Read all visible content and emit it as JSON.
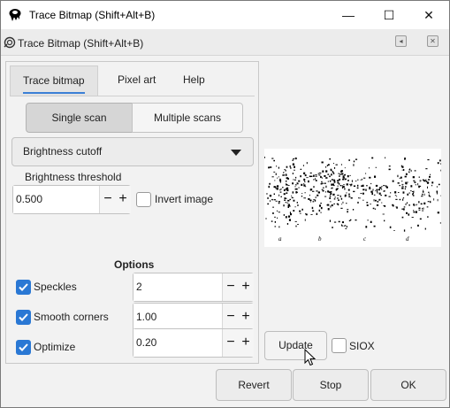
{
  "window": {
    "title": "Trace Bitmap (Shift+Alt+B)",
    "controls": {
      "minimize": "—",
      "maximize": "☐",
      "close": "✕"
    }
  },
  "dock": {
    "title": "Trace Bitmap (Shift+Alt+B)",
    "collapse_icon": "◂",
    "close_icon": "✕"
  },
  "tabs": [
    {
      "label": "Trace bitmap",
      "active": true
    },
    {
      "label": "Pixel art",
      "active": false
    },
    {
      "label": "Help",
      "active": false
    }
  ],
  "scan_mode": {
    "single": "Single scan",
    "multiple": "Multiple scans",
    "selected": "Single scan"
  },
  "detection_mode": {
    "selected": "Brightness cutoff"
  },
  "threshold": {
    "label": "Brightness threshold",
    "value": "0.500",
    "invert_label": "Invert image",
    "invert_checked": false
  },
  "options": {
    "heading": "Options",
    "items": [
      {
        "label": "Speckles",
        "checked": true,
        "value": "2"
      },
      {
        "label": "Smooth corners",
        "checked": true,
        "value": "1.00"
      },
      {
        "label": "Optimize",
        "checked": true,
        "value": "0.20"
      }
    ]
  },
  "preview": {
    "labels": [
      "a",
      "b",
      "c",
      "d"
    ]
  },
  "update": {
    "label": "Update",
    "siox_label": "SIOX",
    "siox_checked": false
  },
  "footer": {
    "revert": "Revert",
    "stop": "Stop",
    "ok": "OK"
  },
  "colors": {
    "accent": "#2a78d4",
    "tab_underline": "#3b7fd6"
  },
  "spin_symbols": {
    "minus": "−",
    "plus": "+"
  }
}
